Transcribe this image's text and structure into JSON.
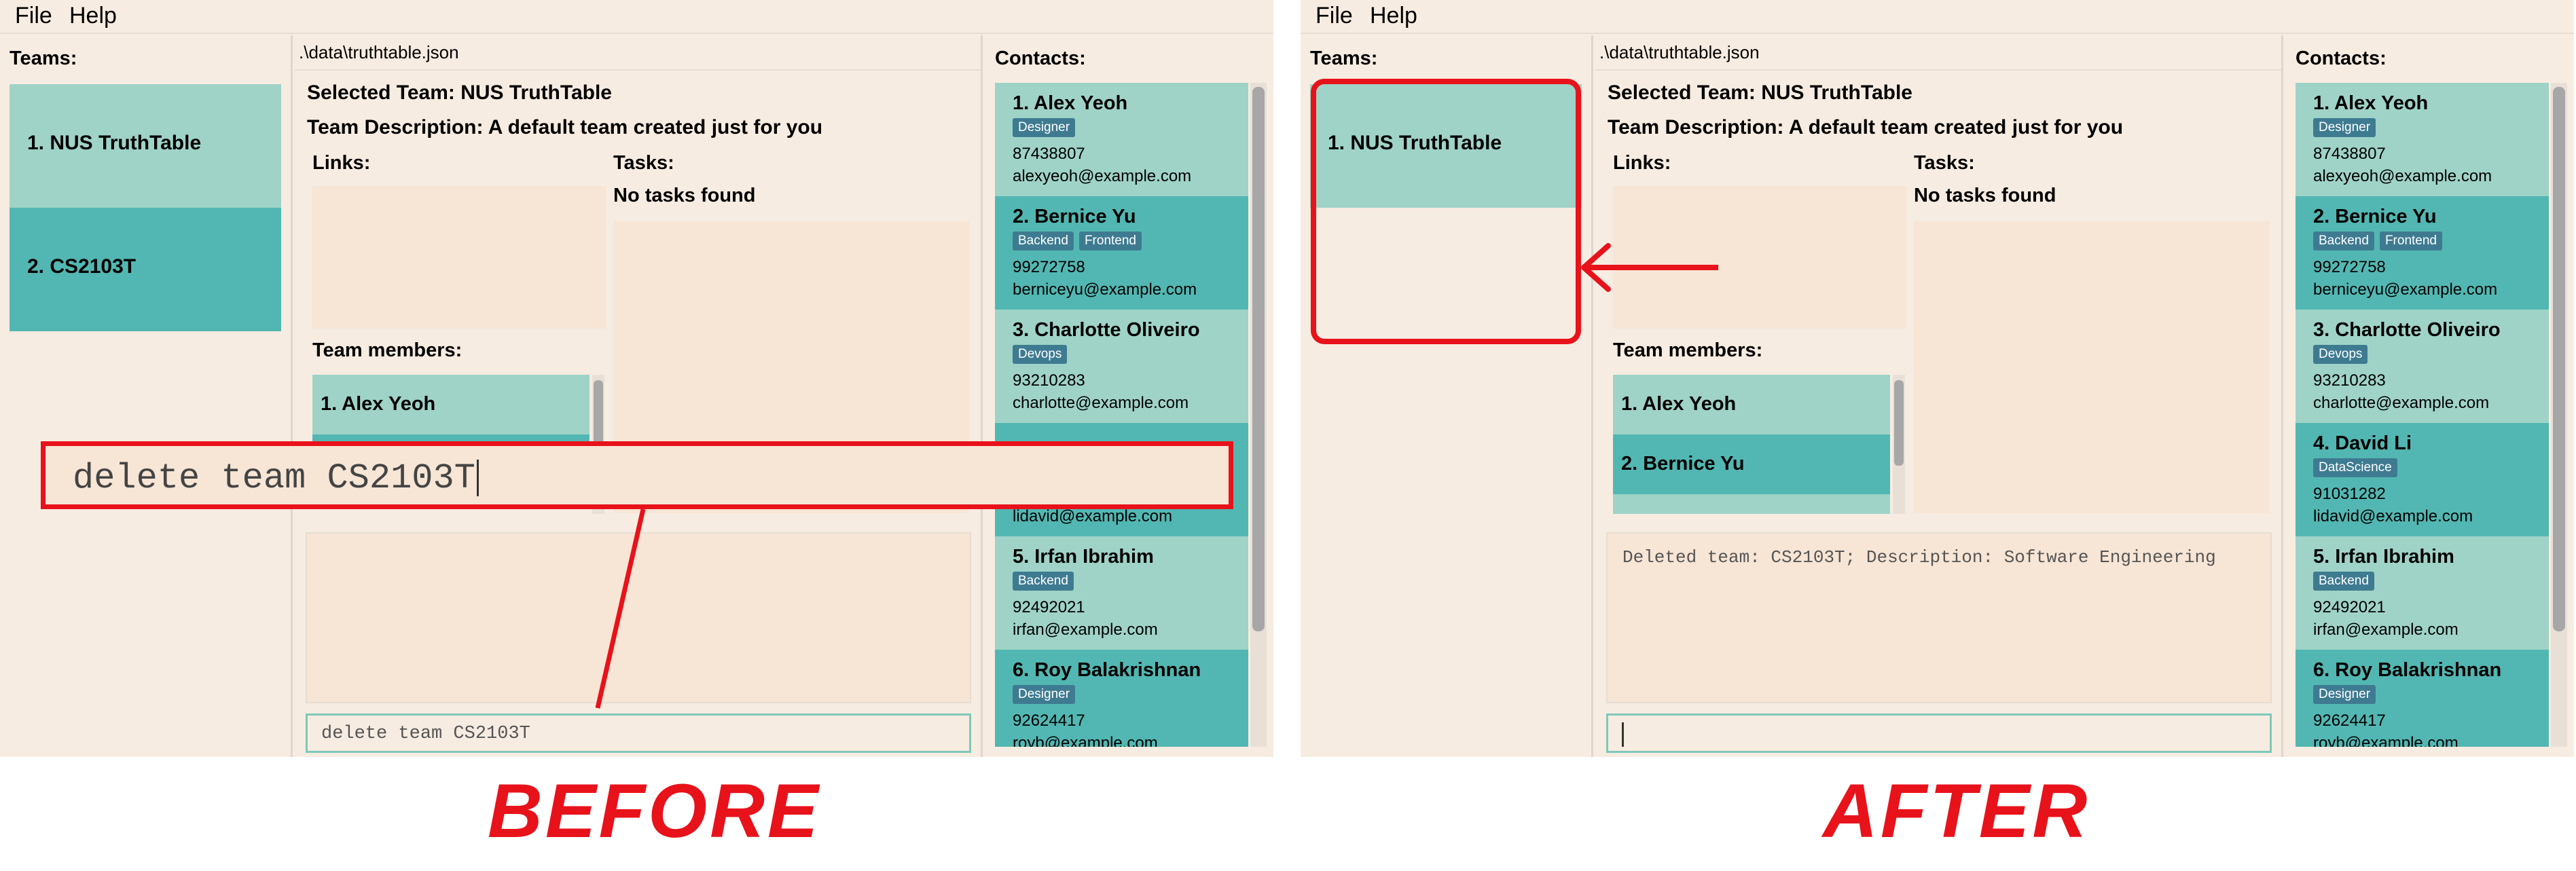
{
  "menu": {
    "file_label": "File",
    "help_label": "Help"
  },
  "teams_title": "Teams:",
  "path": ".\\data\\truthtable.json",
  "selected_team": "Selected Team: NUS TruthTable",
  "team_description": "Team Description: A default team created just for you",
  "links_title": "Links:",
  "tasks_title": "Tasks:",
  "no_tasks": "No tasks found",
  "members_title": "Team members:",
  "contacts_title": "Contacts:",
  "before": {
    "teams": [
      {
        "label": "1. NUS TruthTable"
      },
      {
        "label": "2. CS2103T"
      }
    ],
    "members": [
      {
        "label": "1. Alex Yeoh"
      }
    ],
    "feedback": "",
    "command": "delete team CS2103T",
    "command_overlay": "delete team CS2103T"
  },
  "after": {
    "teams": [
      {
        "label": "1. NUS TruthTable"
      }
    ],
    "members": [
      {
        "label": "1. Alex Yeoh"
      },
      {
        "label": "2. Bernice Yu"
      }
    ],
    "feedback": "Deleted team: CS2103T; Description: Software Engineering",
    "command": ""
  },
  "contacts_before": [
    {
      "name": "1. Alex Yeoh",
      "tags": [
        "Designer"
      ],
      "phone": "87438807",
      "email": "alexyeoh@example.com"
    },
    {
      "name": "2. Bernice Yu",
      "tags": [
        "Backend",
        "Frontend"
      ],
      "phone": "99272758",
      "email": "berniceyu@example.com"
    },
    {
      "name": "3. Charlotte Oliveiro",
      "tags": [
        "Devops"
      ],
      "phone": "93210283",
      "email": "charlotte@example.com"
    },
    {
      "name": "",
      "tags": [],
      "phone": "",
      "email": "lidavid@example.com"
    },
    {
      "name": "5. Irfan Ibrahim",
      "tags": [
        "Backend"
      ],
      "phone": "92492021",
      "email": "irfan@example.com"
    },
    {
      "name": "6. Roy Balakrishnan",
      "tags": [
        "Designer"
      ],
      "phone": "92624417",
      "email": "royb@example.com"
    }
  ],
  "contacts_after": [
    {
      "name": "1. Alex Yeoh",
      "tags": [
        "Designer"
      ],
      "phone": "87438807",
      "email": "alexyeoh@example.com"
    },
    {
      "name": "2. Bernice Yu",
      "tags": [
        "Backend",
        "Frontend"
      ],
      "phone": "99272758",
      "email": "berniceyu@example.com"
    },
    {
      "name": "3. Charlotte Oliveiro",
      "tags": [
        "Devops"
      ],
      "phone": "93210283",
      "email": "charlotte@example.com"
    },
    {
      "name": "4. David Li",
      "tags": [
        "DataScience"
      ],
      "phone": "91031282",
      "email": "lidavid@example.com"
    },
    {
      "name": "5. Irfan Ibrahim",
      "tags": [
        "Backend"
      ],
      "phone": "92492021",
      "email": "irfan@example.com"
    },
    {
      "name": "6. Roy Balakrishnan",
      "tags": [
        "Designer"
      ],
      "phone": "92624417",
      "email": "royb@example.com"
    }
  ],
  "labels": {
    "before": "BEFORE",
    "after": "AFTER"
  },
  "colors": {
    "background": "#f7ece1",
    "card_light": "#9fd3c7",
    "card_dark": "#52b7b2",
    "tag": "#3e7b91",
    "annotation_red": "#e8121b"
  }
}
